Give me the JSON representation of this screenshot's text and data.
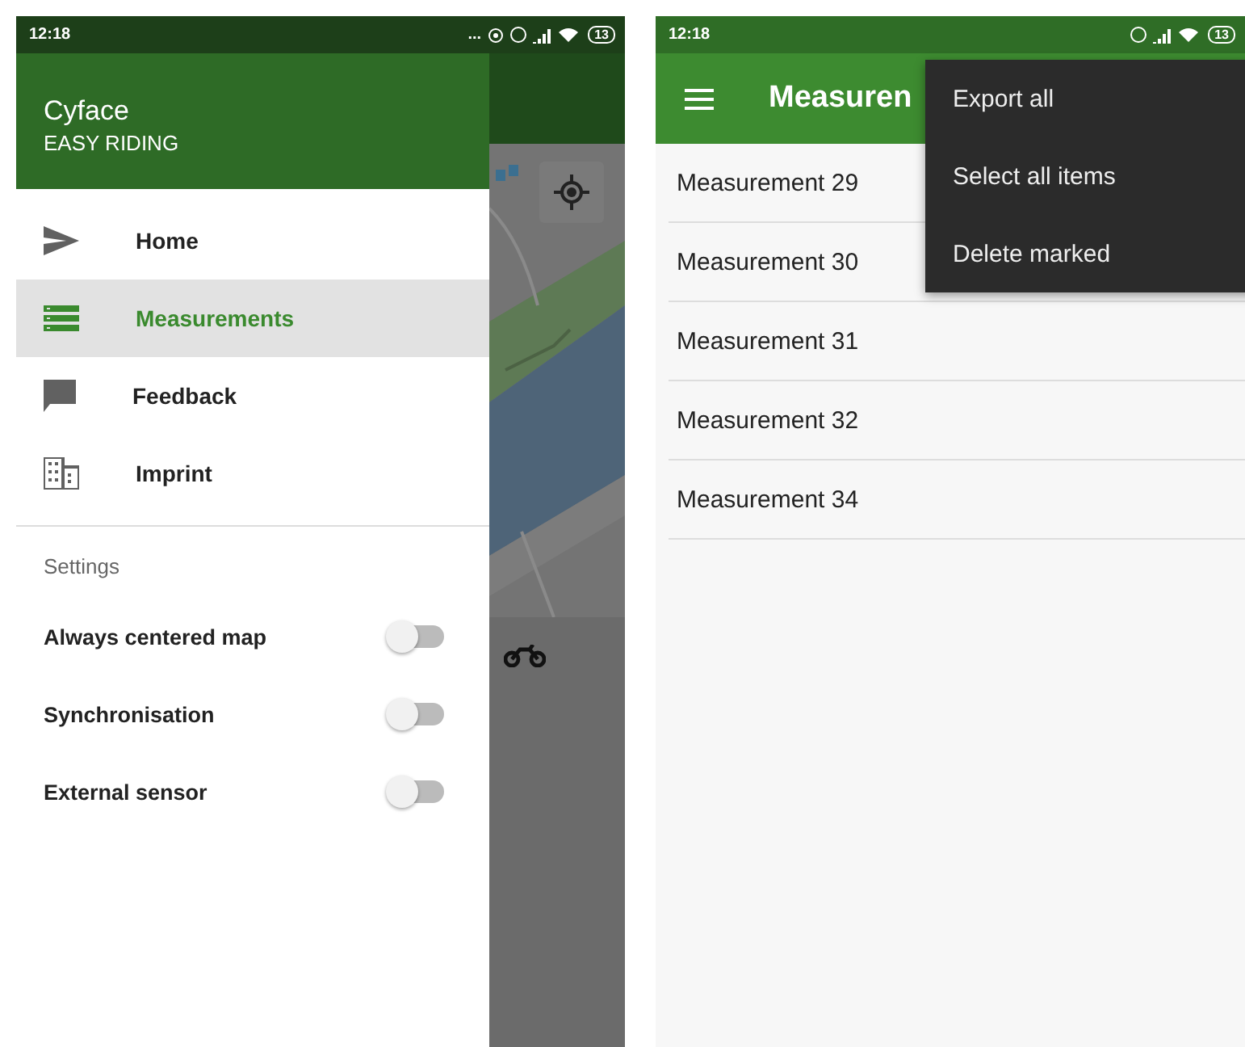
{
  "left_screen": {
    "status_bar": {
      "time": "12:18",
      "overflow": "...",
      "battery": "13"
    },
    "drawer": {
      "app_name": "Cyface",
      "tagline": "EASY RIDING",
      "items": [
        {
          "label": "Home",
          "kind": "send",
          "selected": false
        },
        {
          "label": "Measurements",
          "kind": "list",
          "selected": true
        },
        {
          "label": "Feedback",
          "kind": "chat",
          "selected": false
        },
        {
          "label": "Imprint",
          "kind": "building",
          "selected": false
        }
      ],
      "settings_heading": "Settings",
      "toggles": [
        {
          "label": "Always centered map",
          "on": false
        },
        {
          "label": "Synchronisation",
          "on": false
        },
        {
          "label": "External sensor",
          "on": false
        }
      ]
    }
  },
  "right_screen": {
    "status_bar": {
      "time": "12:18",
      "battery": "13"
    },
    "app_bar": {
      "title": "Measuren"
    },
    "measurements": [
      "Measurement 29",
      "Measurement 30",
      "Measurement 31",
      "Measurement 32",
      "Measurement 34"
    ],
    "menu": [
      "Export all",
      "Select all items",
      "Delete marked"
    ]
  }
}
